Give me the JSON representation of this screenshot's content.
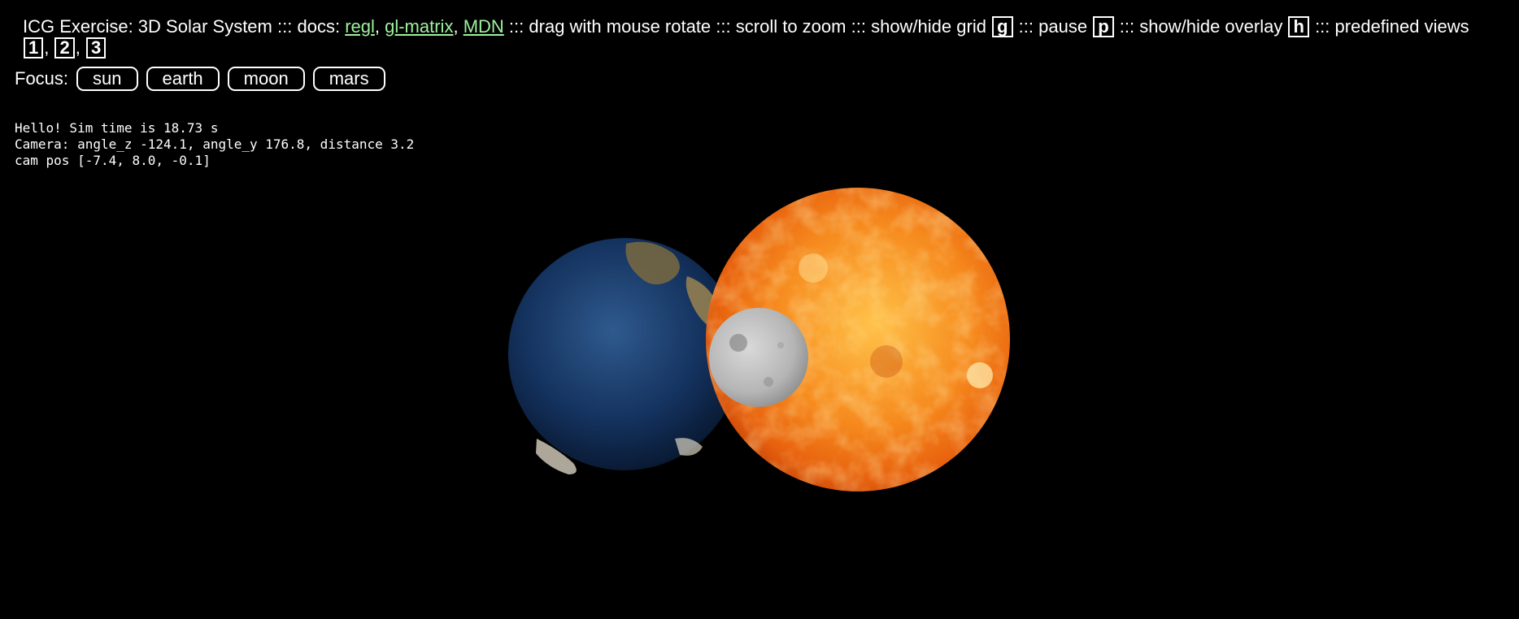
{
  "header": {
    "title": "ICG Exercise: 3D Solar System",
    "sep": ":::",
    "docs_label": "docs:",
    "links": [
      "regl",
      "gl-matrix",
      "MDN"
    ],
    "hint_drag": "drag with mouse rotate",
    "hint_scroll": "scroll to zoom",
    "hint_grid": "show/hide grid",
    "key_grid": "g",
    "hint_pause": "pause",
    "key_pause": "p",
    "hint_overlay": "show/hide overlay",
    "key_overlay": "h",
    "hint_views": "predefined views",
    "view_keys": [
      "1",
      "2",
      "3"
    ]
  },
  "focus": {
    "label": "Focus:",
    "buttons": [
      "sun",
      "earth",
      "moon",
      "mars"
    ]
  },
  "overlay": {
    "line1": "Hello! Sim time is 18.73 s",
    "line2": "Camera: angle_z -124.1, angle_y 176.8, distance 3.2",
    "line3": "cam pos [-7.4, 8.0, -0.1]"
  },
  "colors": {
    "link": "#9ef29e",
    "sun_core": "#ffb23a",
    "sun_edge": "#e35a0a",
    "earth_ocean": "#0e2a55",
    "earth_land": "#c9b27a",
    "moon": "#b9b9b9"
  }
}
